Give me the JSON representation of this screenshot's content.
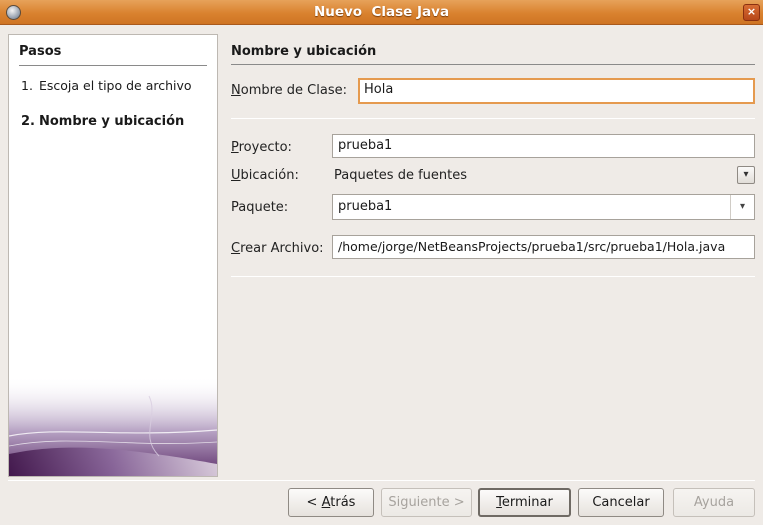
{
  "window": {
    "title": "Nuevo  Clase Java",
    "app_icon": "netbeans-cube-icon",
    "close_glyph": "×"
  },
  "steps": {
    "heading": "Pasos",
    "items": [
      {
        "number": "1.",
        "label": "Escoja el tipo de archivo",
        "current": false
      },
      {
        "number": "2.",
        "label": "Nombre y ubicación",
        "current": true
      }
    ]
  },
  "content": {
    "heading": "Nombre y ubicación",
    "class_name": {
      "label_mnemonic": "N",
      "label_rest": "ombre de Clase:",
      "value": "Hola"
    },
    "project": {
      "label_mnemonic": "P",
      "label_rest": "royecto:",
      "value": "prueba1"
    },
    "location": {
      "label_mnemonic": "U",
      "label_rest": "bicación:",
      "value": "Paquetes de fuentes"
    },
    "package": {
      "label": "Paquete:",
      "value": "prueba1"
    },
    "created_file": {
      "label_mnemonic": "C",
      "label_rest": "rear Archivo:",
      "value": "/home/jorge/NetBeansProjects/prueba1/src/prueba1/Hola.java"
    }
  },
  "buttons": {
    "back": {
      "prefix": "< ",
      "mnemonic": "A",
      "rest": "trás",
      "enabled": true
    },
    "next": {
      "label": "Siguiente >",
      "enabled": false
    },
    "finish": {
      "mnemonic": "T",
      "rest": "erminar",
      "enabled": true
    },
    "cancel": {
      "label": "Cancelar",
      "enabled": true
    },
    "help": {
      "label": "Ayuda",
      "enabled": false
    }
  },
  "colors": {
    "titlebar_accent": "#d9822f",
    "focus_border": "#e59a4f",
    "dialog_background": "#efebe7"
  }
}
